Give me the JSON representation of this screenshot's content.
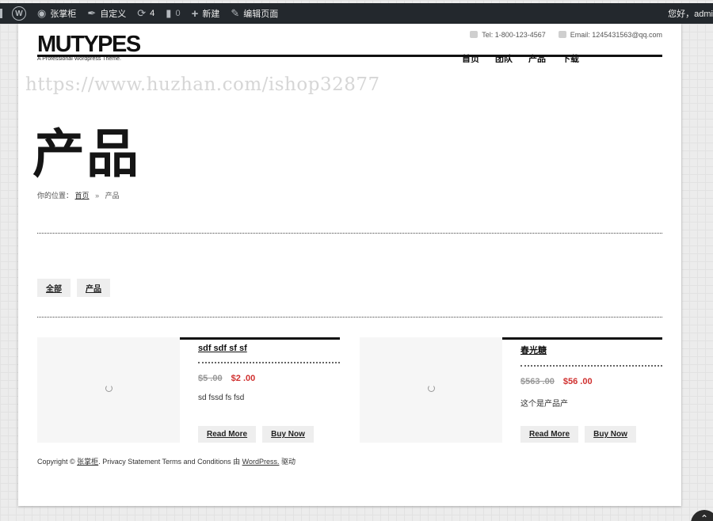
{
  "adminbar": {
    "site_name": "张掌柜",
    "customize": "自定义",
    "updates_count": "4",
    "comments_count": "0",
    "new_label": "新建",
    "edit_page": "编辑页面",
    "greeting": "您好，admi"
  },
  "header": {
    "logo": "MUTYPES",
    "tagline": "A Professional Wordpress Theme.",
    "tel": "Tel: 1-800-123-4567",
    "email": "Email: 1245431563@qq.com",
    "nav": [
      "首页",
      "团队",
      "产品",
      "下载"
    ]
  },
  "watermark": "https://www.huzhan.com/ishop32877",
  "page_title": "产品",
  "breadcrumb": {
    "prefix": "你的位置：",
    "home": "首页",
    "sep": "»",
    "current": "产品"
  },
  "filters": [
    "全部",
    "产品"
  ],
  "products": [
    {
      "title": "sdf sdf sf sf",
      "old_price": "$5 .00",
      "price": "$2 .00",
      "desc": "sd fssd fs fsd",
      "read_more": "Read More",
      "buy_now": "Buy Now"
    },
    {
      "title": "春光糖",
      "old_price": "$563 .00",
      "price": "$56 .00",
      "desc": "这个是产品产",
      "read_more": "Read More",
      "buy_now": "Buy Now"
    }
  ],
  "footer": {
    "copyright": "Copyright ©",
    "owner": "张掌柜",
    "links": ". Privacy Statement Terms and Conditions 由",
    "powered": "WordPress.",
    "driven": "驱动"
  },
  "scroll_top_icon": "chevron-up-icon"
}
